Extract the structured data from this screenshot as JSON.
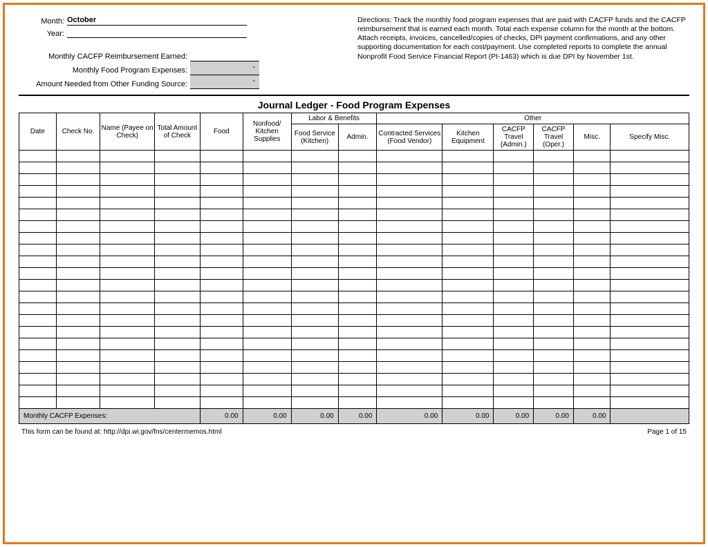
{
  "header": {
    "month_label": "Month:",
    "month_value": "October",
    "year_label": "Year:",
    "year_value": "",
    "reimbursement_label": "Monthly CACFP Reimbursement Earned:",
    "reimbursement_value": "",
    "expenses_label": "Monthly Food Program Expenses:",
    "expenses_value": "-",
    "other_funding_label": "Amount Needed from Other Funding Source:",
    "other_funding_value": "-",
    "directions": "Directions: Track the monthly food program expenses that are paid with CACFP funds and the CACFP reimbursement that is earned each month. Total each expense column for the month at the bottom. Attach receipts, invoices, cancelled/copies of checks, DPI payment confirmations, and any other supporting documentation for each cost/payment. Use completed reports to complete the annual Nonprofit Food Service Financial Report (PI-1463) which is due DPI by November 1st."
  },
  "table": {
    "title": "Journal Ledger - Food Program Expenses",
    "group_labor": "Labor & Benefits",
    "group_other": "Other",
    "columns": {
      "date": "Date",
      "check_no": "Check No.",
      "name": "Name (Payee on Check)",
      "total": "Total Amount of Check",
      "food": "Food",
      "nonfood": "Nonfood/ Kitchen Supplies",
      "food_service": "Food Service (Kitchen)",
      "admin": "Admin.",
      "contracted": "Contracted Services (Food Vendor)",
      "equipment": "Kitchen Equipment",
      "travel_admin": "CACFP Travel (Admin.)",
      "travel_oper": "CACFP Travel (Oper.)",
      "misc": "Misc.",
      "specify": "Specify Misc."
    },
    "totals_label": "Monthly CACFP Expenses:",
    "totals": {
      "food": "0.00",
      "nonfood": "0.00",
      "food_service": "0.00",
      "admin": "0.00",
      "contracted": "0.00",
      "equipment": "0.00",
      "travel_admin": "0.00",
      "travel_oper": "0.00",
      "misc": "0.00"
    }
  },
  "footer": {
    "source": "This form can be found at: http://dpi.wi.gov/fns/centermemos.html",
    "page": "Page 1 of 15"
  }
}
